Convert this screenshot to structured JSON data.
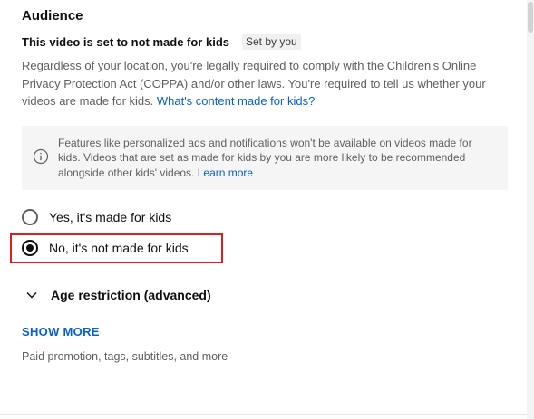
{
  "audience": {
    "title": "Audience",
    "status_text": "This video is set to not made for kids",
    "status_badge": "Set by you",
    "description": "Regardless of your location, you're legally required to comply with the Children's Online Privacy Protection Act (COPPA) and/or other laws. You're required to tell us whether your videos are made for kids.",
    "description_link": "What's content made for kids?",
    "info_text": "Features like personalized ads and notifications won't be available on videos made for kids. Videos that are set as made for kids by you are more likely to be recommended alongside other kids' videos.",
    "info_link": "Learn more",
    "info_icon": "info-circle-icon",
    "options": [
      {
        "label": "Yes, it's made for kids",
        "selected": false
      },
      {
        "label": "No, it's not made for kids",
        "selected": true
      }
    ]
  },
  "age_restriction": {
    "label": "Age restriction (advanced)",
    "icon": "chevron-down-icon"
  },
  "show_more": {
    "label": "SHOW MORE",
    "description": "Paid promotion, tags, subtitles, and more"
  },
  "colors": {
    "link": "#065fd4",
    "highlight": "#e31b1b",
    "secondary_text": "#606060"
  }
}
